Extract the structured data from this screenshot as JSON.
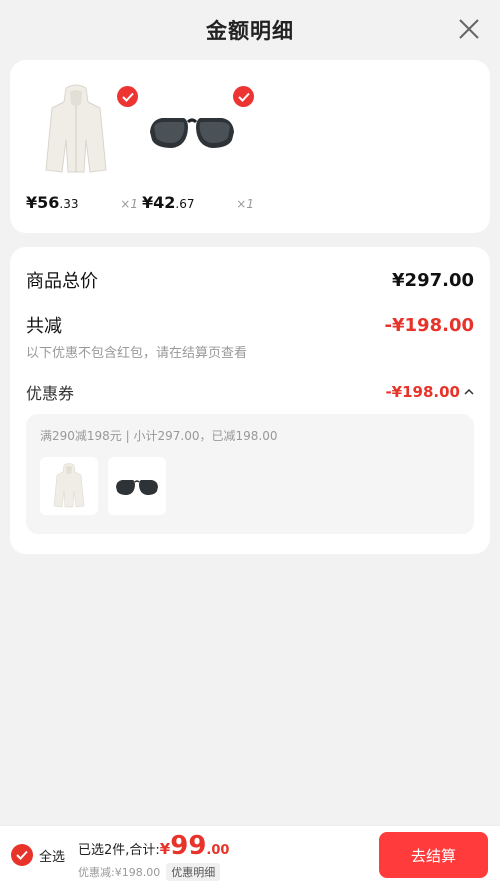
{
  "header": {
    "title": "金额明细",
    "close_icon": "close-icon"
  },
  "products": [
    {
      "name": "white-hooded-jacket",
      "price_int": "¥56",
      "price_dec": ".33",
      "qty": "×1"
    },
    {
      "name": "black-sunglasses",
      "price_int": "¥42",
      "price_dec": ".67",
      "qty": "×1"
    }
  ],
  "summary": {
    "total_label": "商品总价",
    "total_value": "¥297.00",
    "discount_label": "共减",
    "discount_value": "-¥198.00",
    "discount_hint": "以下优惠不包含红包，请在结算页查看",
    "coupon_label": "优惠券",
    "coupon_value": "-¥198.00",
    "coupon_detail": "满290减198元 | 小计297.00，已减198.00"
  },
  "bottom": {
    "select_all": "全选",
    "selected_text": "已选2件,合计:",
    "currency": "¥",
    "total_int": "99",
    "total_dec": ".00",
    "discount_text": "优惠减:¥198.00",
    "detail_tag": "优惠明细",
    "checkout": "去结算"
  },
  "colors": {
    "accent": "#e8332a",
    "button": "#ff3b3b",
    "background": "#f2f2f2"
  }
}
